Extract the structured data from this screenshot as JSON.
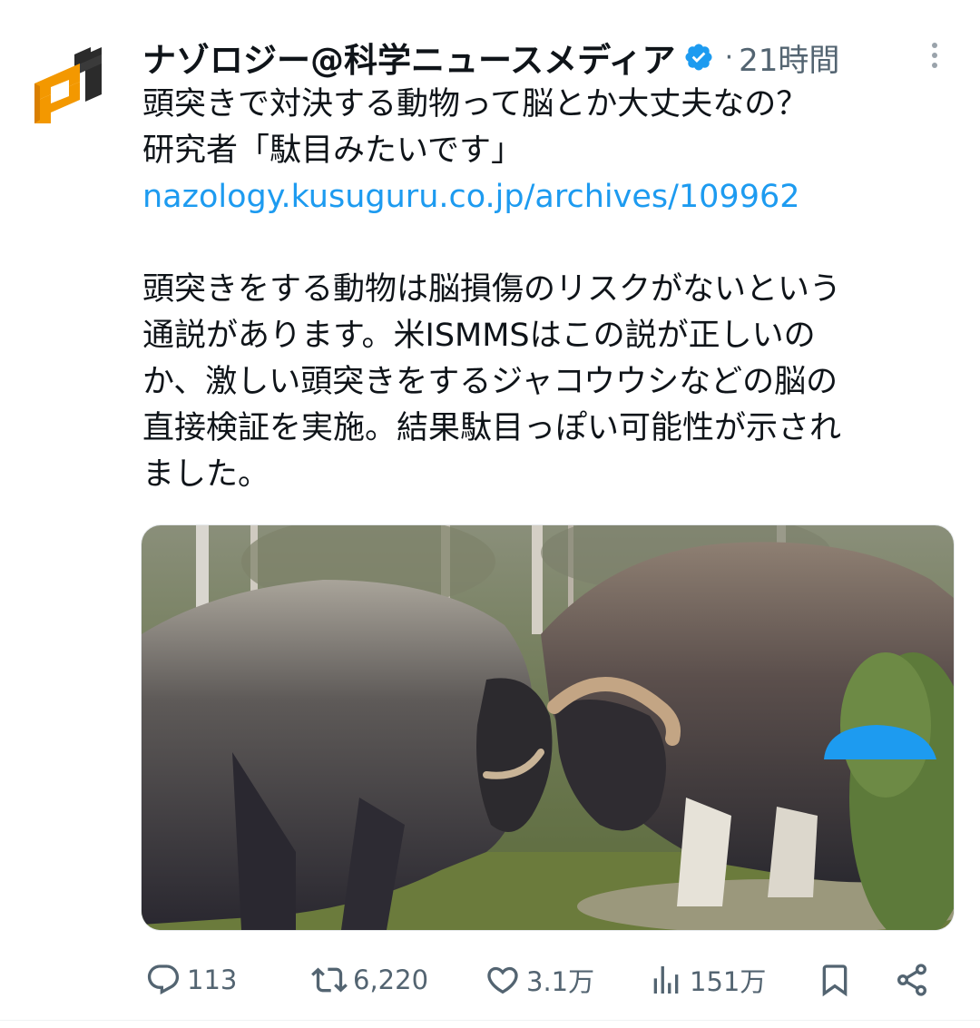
{
  "tweet": {
    "author": "ナゾロジー@科学ニュースメディア",
    "time": "21時間",
    "separator": "·",
    "headline": [
      "頭突きで対決する動物って脳とか大丈夫なの？",
      "研究者「駄目みたいです」"
    ],
    "link": "nazology.kusuguru.co.jp/archives/109962",
    "paragraph": [
      "頭突きをする動物は脳損傷のリスクがないという",
      "通説があります。米ISMMSはこの説が正しいの",
      "か、激しい頭突きをするジャコウウシなどの脳の",
      "直接検証を実施。結果駄目っぽい可能性が示され",
      "ました。"
    ]
  },
  "actions": {
    "replies": "113",
    "retweets": "6,220",
    "likes": "3.1万",
    "views": "151万"
  },
  "icons": {
    "avatar": "nazology-logo-icon",
    "verified": "verified-badge-icon",
    "more": "more-vertical-icon",
    "reply": "reply-icon",
    "retweet": "retweet-icon",
    "like": "heart-icon",
    "views": "views-chart-icon",
    "bookmark": "bookmark-icon",
    "share": "share-icon"
  },
  "colors": {
    "link": "#1d9bf0",
    "secondary": "#536471",
    "verified": "#1d9bf0",
    "logo_orange": "#f39800"
  }
}
